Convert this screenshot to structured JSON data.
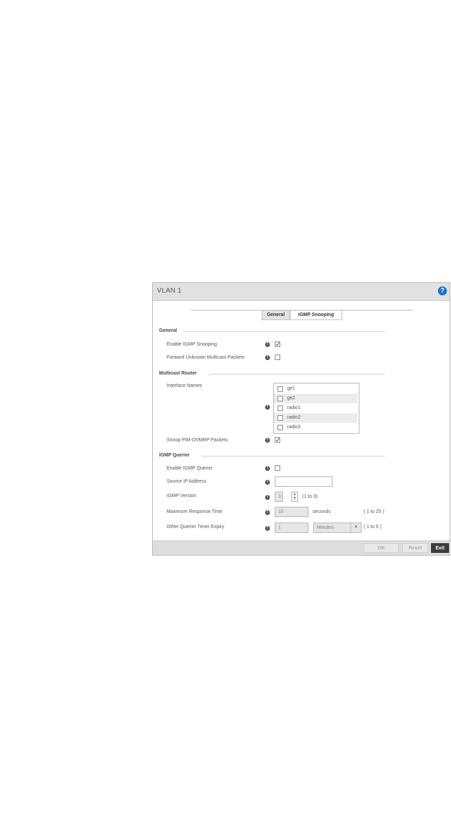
{
  "dialog": {
    "title": "VLAN   1",
    "help_icon": "question-circle-icon"
  },
  "tabs": [
    {
      "label": "General",
      "active": true
    },
    {
      "label": "IGMP Snooping",
      "active": false
    }
  ],
  "general": {
    "heading": "General",
    "enable_igmp_snooping": {
      "label": "Enable IGMP Snooping",
      "checked": true
    },
    "forward_unknown_multicast": {
      "label": "Forward Unknown Multicast Packets",
      "checked": false
    }
  },
  "multicast_router": {
    "heading": "Multicast Router",
    "interface_names_label": "Interface Names",
    "interfaces": [
      {
        "name": "ge1",
        "checked": false
      },
      {
        "name": "ge2",
        "checked": false
      },
      {
        "name": "radio1",
        "checked": false
      },
      {
        "name": "radio2",
        "checked": false
      },
      {
        "name": "radio3",
        "checked": false
      }
    ],
    "snoop_pim": {
      "label": "Snoop PIM-DVMRP Packets",
      "checked": true
    }
  },
  "igmp_querier": {
    "heading": "IGMP Querier",
    "enable_querier": {
      "label": "Enable IGMP Querier",
      "checked": false
    },
    "source_ip": {
      "label": "Source IP Address",
      "value": ".   .   ."
    },
    "igmp_version": {
      "label": "IGMP Version",
      "value": "3",
      "range": "(1 to 3)"
    },
    "max_response_time": {
      "label": "Maximum Response Time",
      "value": "10",
      "unit": "seconds",
      "range": "( 1 to 25 )"
    },
    "other_querier_timer": {
      "label": "Other Querier Timer Expiry",
      "value": "1",
      "unit": "Minutes",
      "range": "( 1 to 5 )"
    }
  },
  "footer": {
    "ok_label": "OK",
    "reset_label": "Reset",
    "exit_label": "Exit"
  }
}
